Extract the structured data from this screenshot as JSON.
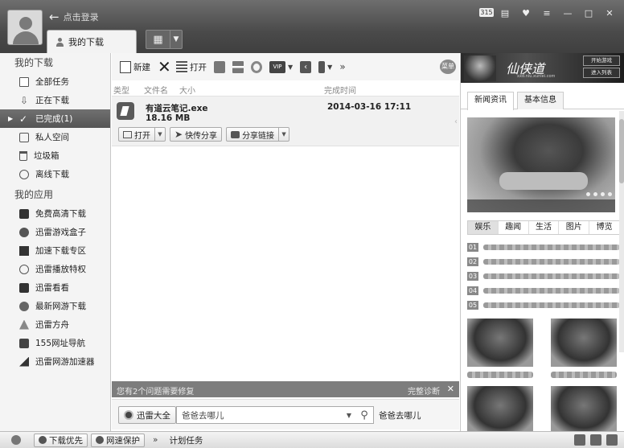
{
  "titlebar": {
    "login_text": "点击登录",
    "tab_label": "我的下载",
    "badge": "315"
  },
  "sidebar": {
    "section1": "我的下载",
    "downloads": [
      {
        "label": "全部任务",
        "icon": "doc-icon"
      },
      {
        "label": "正在下载",
        "icon": "download-icon"
      },
      {
        "label": "已完成(1)",
        "icon": "check-icon",
        "active": true
      },
      {
        "label": "私人空间",
        "icon": "lock-icon"
      },
      {
        "label": "垃圾箱",
        "icon": "trash-icon"
      },
      {
        "label": "离线下载",
        "icon": "cloud-icon"
      }
    ],
    "section2": "我的应用",
    "apps": [
      {
        "label": "免费高清下载",
        "icon": "hd-icon"
      },
      {
        "label": "迅雷游戏盒子",
        "icon": "game-box-icon"
      },
      {
        "label": "加速下载专区",
        "icon": "speed-icon"
      },
      {
        "label": "迅雷播放特权",
        "icon": "play-icon"
      },
      {
        "label": "迅雷看看",
        "icon": "tv-icon"
      },
      {
        "label": "最新网游下载",
        "icon": "game5-icon"
      },
      {
        "label": "迅雷方舟",
        "icon": "ark-icon"
      },
      {
        "label": "155网址导航",
        "icon": "nav155-icon"
      },
      {
        "label": "迅雷网游加速器",
        "icon": "accelerator-icon"
      }
    ]
  },
  "toolbar": {
    "new_label": "新建",
    "open_label": "打开",
    "more": "»",
    "menu_label": "菜单"
  },
  "list": {
    "columns": {
      "type": "类型",
      "filename": "文件名",
      "size": "大小",
      "time": "完成时间"
    },
    "file": {
      "name": "有道云笔记.exe",
      "size": "18.16 MB",
      "completed": "2014-03-16 17:11"
    },
    "actions": {
      "open": "打开",
      "quick_share": "快传分享",
      "share_link": "分享链接"
    }
  },
  "repair": {
    "message": "您有2个问题需要修复",
    "diagnose": "完整诊断"
  },
  "search": {
    "brand": "迅雷大全",
    "value": "爸爸去哪儿",
    "suggestion": "爸爸去哪儿"
  },
  "rightpanel": {
    "banner_title": "仙侠道",
    "banner_url": "xxd.niu.xunlei.com",
    "banner_start": "开始游戏",
    "banner_enter": "进入列表",
    "tabs": [
      "新闻资讯",
      "基本信息"
    ],
    "categories": [
      "娱乐",
      "趣闻",
      "生活",
      "图片",
      "博览"
    ],
    "news_numbers": [
      "01",
      "02",
      "03",
      "04",
      "05"
    ]
  },
  "statusbar": {
    "download_priority": "下载优先",
    "net_protect": "网速保护",
    "more": "»",
    "schedule": "计划任务"
  }
}
